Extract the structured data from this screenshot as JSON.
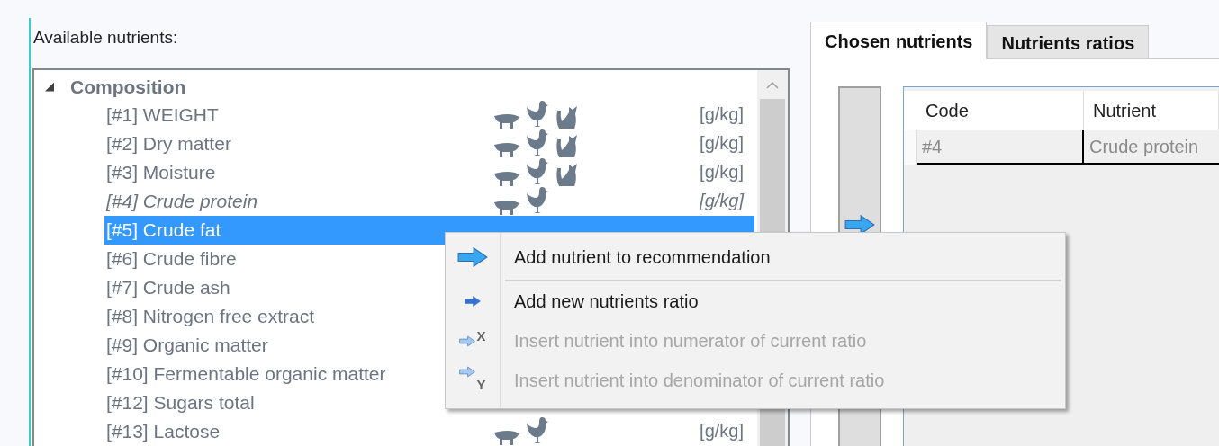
{
  "left_panel": {
    "label": "Available nutrients:"
  },
  "tree": {
    "group": {
      "label": "Composition",
      "expanded": true,
      "children": [
        {
          "label": "[#1] WEIGHT",
          "selected": false,
          "chosen": false,
          "pig": true,
          "chicken": true,
          "cat": true,
          "unit": "[g/kg]"
        },
        {
          "label": "[#2] Dry matter",
          "selected": false,
          "chosen": false,
          "pig": true,
          "chicken": true,
          "cat": true,
          "unit": "[g/kg]"
        },
        {
          "label": "[#3] Moisture",
          "selected": false,
          "chosen": false,
          "pig": true,
          "chicken": true,
          "cat": true,
          "unit": "[g/kg]"
        },
        {
          "label": "[#4] Crude protein",
          "selected": false,
          "chosen": true,
          "pig": true,
          "chicken": true,
          "unit": "[g/kg]"
        },
        {
          "label": "[#5] Crude fat",
          "selected": true,
          "chosen": false
        },
        {
          "label": "[#6] Crude fibre",
          "selected": false,
          "chosen": false
        },
        {
          "label": "[#7] Crude ash",
          "selected": false,
          "chosen": false
        },
        {
          "label": "[#8] Nitrogen free extract",
          "selected": false,
          "chosen": false
        },
        {
          "label": "[#9] Organic matter",
          "selected": false,
          "chosen": false
        },
        {
          "label": "[#10] Fermentable organic matter",
          "selected": false,
          "chosen": false
        },
        {
          "label": "[#12] Sugars total",
          "selected": false,
          "chosen": false
        },
        {
          "label": "[#13] Lactose",
          "selected": false,
          "chosen": false,
          "pig": true,
          "chicken": true,
          "unit": "[g/kg]"
        }
      ]
    }
  },
  "tabs": [
    {
      "label": "Chosen nutrients",
      "selected": true
    },
    {
      "label": "Nutrients ratios",
      "selected": false
    }
  ],
  "grid": {
    "columns": [
      "Code",
      "Nutrient"
    ],
    "rows": [
      [
        "#4",
        "Crude protein"
      ]
    ]
  },
  "context_menu": [
    {
      "label": "Add nutrient to recommendation",
      "kind": "big-arrow",
      "disabled": false,
      "separator_after": true
    },
    {
      "label": "Add new nutrients ratio",
      "kind": "small-arrow",
      "disabled": false
    },
    {
      "label": "Insert nutrient into numerator of current ratio",
      "kind": "badge-arrow",
      "badge": "X",
      "disabled": true
    },
    {
      "label": "Insert nutrient into denominator of current ratio",
      "kind": "badge-arrow",
      "badge": "Y",
      "disabled": true
    }
  ]
}
